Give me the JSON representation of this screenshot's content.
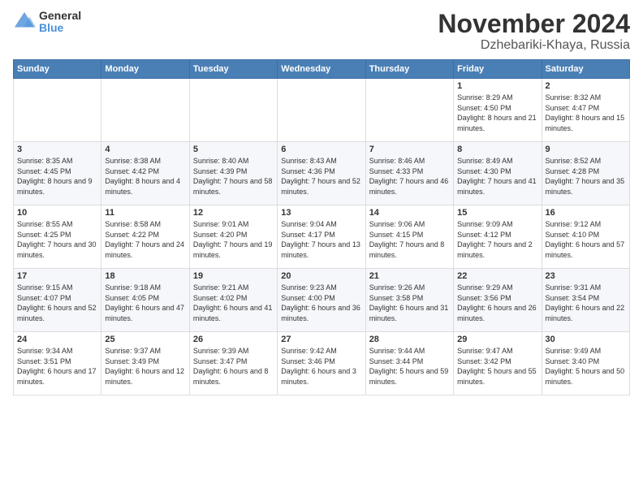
{
  "header": {
    "logo_general": "General",
    "logo_blue": "Blue",
    "title": "November 2024",
    "location": "Dzhebariki-Khaya, Russia"
  },
  "weekdays": [
    "Sunday",
    "Monday",
    "Tuesday",
    "Wednesday",
    "Thursday",
    "Friday",
    "Saturday"
  ],
  "weeks": [
    [
      {
        "day": "",
        "info": ""
      },
      {
        "day": "",
        "info": ""
      },
      {
        "day": "",
        "info": ""
      },
      {
        "day": "",
        "info": ""
      },
      {
        "day": "",
        "info": ""
      },
      {
        "day": "1",
        "info": "Sunrise: 8:29 AM\nSunset: 4:50 PM\nDaylight: 8 hours and 21 minutes."
      },
      {
        "day": "2",
        "info": "Sunrise: 8:32 AM\nSunset: 4:47 PM\nDaylight: 8 hours and 15 minutes."
      }
    ],
    [
      {
        "day": "3",
        "info": "Sunrise: 8:35 AM\nSunset: 4:45 PM\nDaylight: 8 hours and 9 minutes."
      },
      {
        "day": "4",
        "info": "Sunrise: 8:38 AM\nSunset: 4:42 PM\nDaylight: 8 hours and 4 minutes."
      },
      {
        "day": "5",
        "info": "Sunrise: 8:40 AM\nSunset: 4:39 PM\nDaylight: 7 hours and 58 minutes."
      },
      {
        "day": "6",
        "info": "Sunrise: 8:43 AM\nSunset: 4:36 PM\nDaylight: 7 hours and 52 minutes."
      },
      {
        "day": "7",
        "info": "Sunrise: 8:46 AM\nSunset: 4:33 PM\nDaylight: 7 hours and 46 minutes."
      },
      {
        "day": "8",
        "info": "Sunrise: 8:49 AM\nSunset: 4:30 PM\nDaylight: 7 hours and 41 minutes."
      },
      {
        "day": "9",
        "info": "Sunrise: 8:52 AM\nSunset: 4:28 PM\nDaylight: 7 hours and 35 minutes."
      }
    ],
    [
      {
        "day": "10",
        "info": "Sunrise: 8:55 AM\nSunset: 4:25 PM\nDaylight: 7 hours and 30 minutes."
      },
      {
        "day": "11",
        "info": "Sunrise: 8:58 AM\nSunset: 4:22 PM\nDaylight: 7 hours and 24 minutes."
      },
      {
        "day": "12",
        "info": "Sunrise: 9:01 AM\nSunset: 4:20 PM\nDaylight: 7 hours and 19 minutes."
      },
      {
        "day": "13",
        "info": "Sunrise: 9:04 AM\nSunset: 4:17 PM\nDaylight: 7 hours and 13 minutes."
      },
      {
        "day": "14",
        "info": "Sunrise: 9:06 AM\nSunset: 4:15 PM\nDaylight: 7 hours and 8 minutes."
      },
      {
        "day": "15",
        "info": "Sunrise: 9:09 AM\nSunset: 4:12 PM\nDaylight: 7 hours and 2 minutes."
      },
      {
        "day": "16",
        "info": "Sunrise: 9:12 AM\nSunset: 4:10 PM\nDaylight: 6 hours and 57 minutes."
      }
    ],
    [
      {
        "day": "17",
        "info": "Sunrise: 9:15 AM\nSunset: 4:07 PM\nDaylight: 6 hours and 52 minutes."
      },
      {
        "day": "18",
        "info": "Sunrise: 9:18 AM\nSunset: 4:05 PM\nDaylight: 6 hours and 47 minutes."
      },
      {
        "day": "19",
        "info": "Sunrise: 9:21 AM\nSunset: 4:02 PM\nDaylight: 6 hours and 41 minutes."
      },
      {
        "day": "20",
        "info": "Sunrise: 9:23 AM\nSunset: 4:00 PM\nDaylight: 6 hours and 36 minutes."
      },
      {
        "day": "21",
        "info": "Sunrise: 9:26 AM\nSunset: 3:58 PM\nDaylight: 6 hours and 31 minutes."
      },
      {
        "day": "22",
        "info": "Sunrise: 9:29 AM\nSunset: 3:56 PM\nDaylight: 6 hours and 26 minutes."
      },
      {
        "day": "23",
        "info": "Sunrise: 9:31 AM\nSunset: 3:54 PM\nDaylight: 6 hours and 22 minutes."
      }
    ],
    [
      {
        "day": "24",
        "info": "Sunrise: 9:34 AM\nSunset: 3:51 PM\nDaylight: 6 hours and 17 minutes."
      },
      {
        "day": "25",
        "info": "Sunrise: 9:37 AM\nSunset: 3:49 PM\nDaylight: 6 hours and 12 minutes."
      },
      {
        "day": "26",
        "info": "Sunrise: 9:39 AM\nSunset: 3:47 PM\nDaylight: 6 hours and 8 minutes."
      },
      {
        "day": "27",
        "info": "Sunrise: 9:42 AM\nSunset: 3:46 PM\nDaylight: 6 hours and 3 minutes."
      },
      {
        "day": "28",
        "info": "Sunrise: 9:44 AM\nSunset: 3:44 PM\nDaylight: 5 hours and 59 minutes."
      },
      {
        "day": "29",
        "info": "Sunrise: 9:47 AM\nSunset: 3:42 PM\nDaylight: 5 hours and 55 minutes."
      },
      {
        "day": "30",
        "info": "Sunrise: 9:49 AM\nSunset: 3:40 PM\nDaylight: 5 hours and 50 minutes."
      }
    ]
  ]
}
